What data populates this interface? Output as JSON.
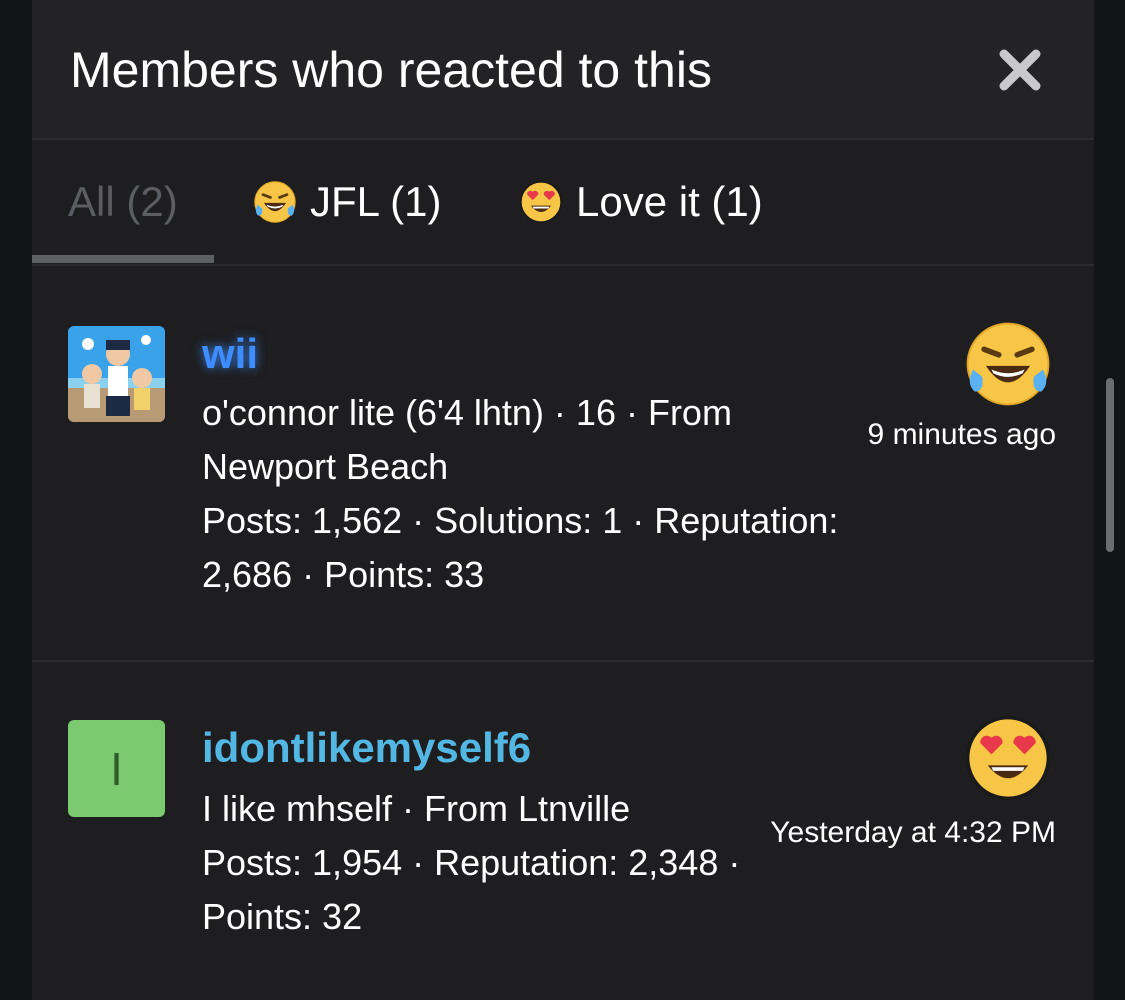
{
  "modal": {
    "title": "Members who reacted to this",
    "close_icon": "close-icon"
  },
  "tabs": [
    {
      "label": "All (2)",
      "selected": true,
      "icon": ""
    },
    {
      "label": "JFL (1)",
      "selected": false,
      "icon": "laugh-cry-emoji-icon"
    },
    {
      "label": "Love it (1)",
      "selected": false,
      "icon": "heart-eyes-emoji-icon"
    }
  ],
  "members": [
    {
      "username": "wii",
      "details": "o'connor lite (6'4 lhtn) · 16 · From Newport Beach",
      "stats": "Posts: 1,562 · Solutions: 1 · Reputation: 2,686 · Points: 33",
      "time": "9 minutes ago",
      "reaction_icon": "laugh-cry-emoji-icon",
      "avatar": "photo-avatar",
      "username_color": "#3d8dff"
    },
    {
      "username": "idontlikemyself6",
      "details": "I like mhself · From Ltnville",
      "stats": "Posts: 1,954 · Reputation: 2,348 · Points: 32",
      "time": "Yesterday at 4:32 PM",
      "reaction_icon": "heart-eyes-emoji-icon",
      "avatar_letter": "I",
      "avatar_color": "#7bca6f",
      "username_color": "#52b7e3"
    }
  ]
}
